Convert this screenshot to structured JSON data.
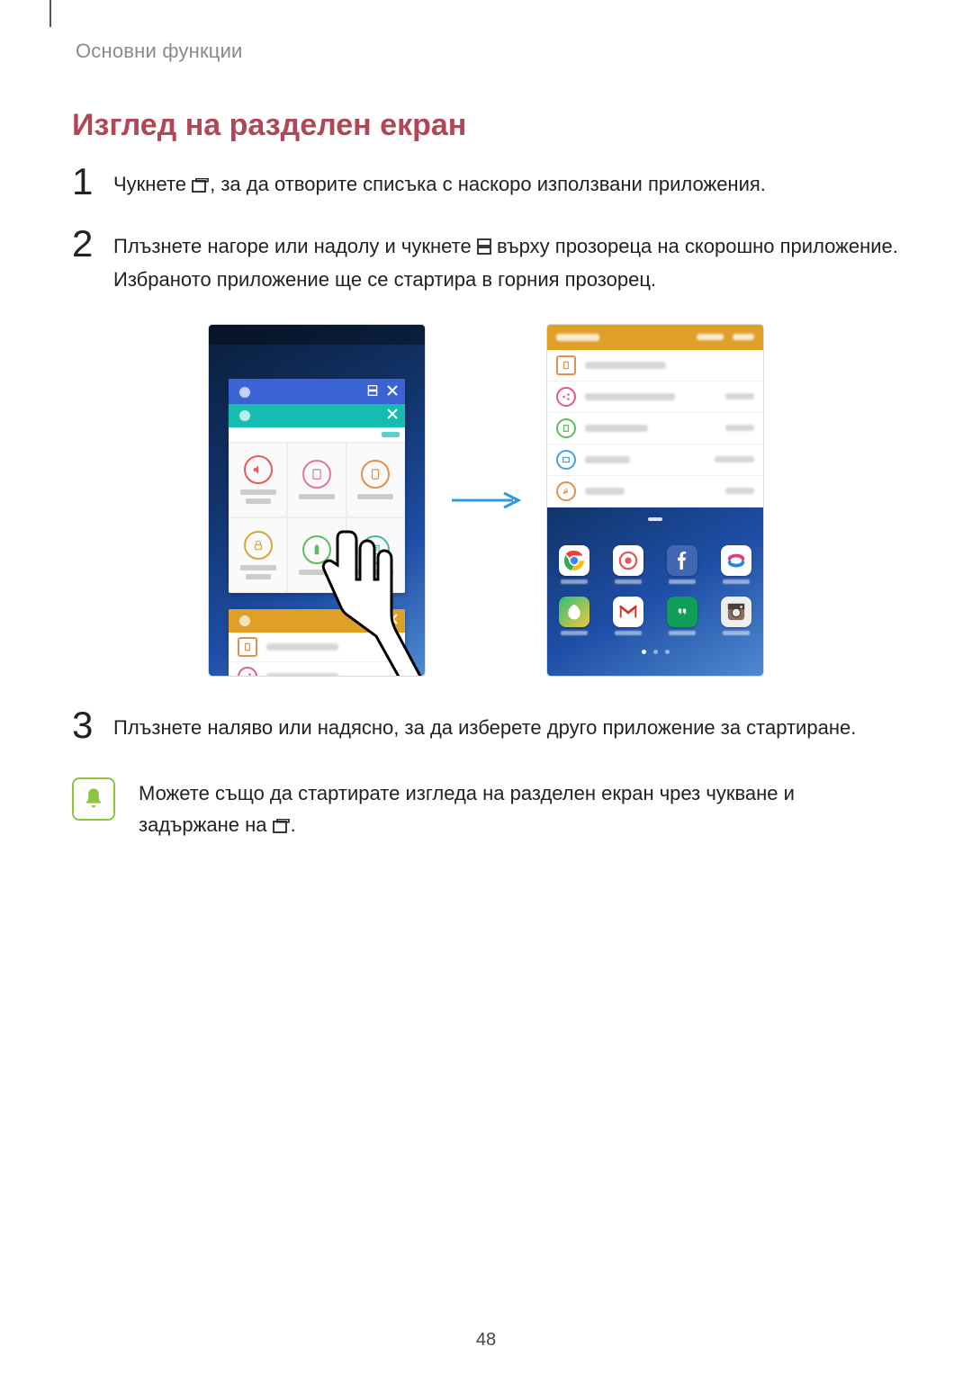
{
  "breadcrumb": "Основни функции",
  "section_title": "Изглед на разделен екран",
  "steps": [
    {
      "n": "1",
      "text_before_icon": "Чукнете ",
      "icon": "recent-apps-icon",
      "text_after_icon": ", за да отворите списъка с наскоро използвани приложения."
    },
    {
      "n": "2",
      "text_before_icon": "Плъзнете нагоре или надолу и чукнете ",
      "icon": "split-view-icon",
      "text_after_icon": " върху прозореца на скорошно приложение. Избраното приложение ще се стартира в горния прозорец."
    },
    {
      "n": "3",
      "text": "Плъзнете наляво или надясно, за да изберете друго приложение за стартиране."
    }
  ],
  "tip": {
    "text_before_icon": "Можете също да стартирате изгледа на разделен екран чрез чукване и задържане на ",
    "icon": "recent-apps-icon",
    "text_after_icon": "."
  },
  "page_number": "48"
}
